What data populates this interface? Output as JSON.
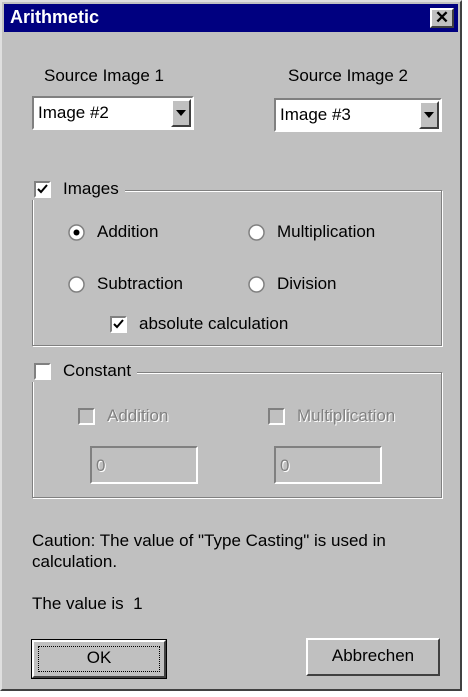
{
  "window": {
    "title": "Arithmetic"
  },
  "source1": {
    "label": "Source Image 1",
    "value": "Image #2"
  },
  "source2": {
    "label": "Source Image 2",
    "value": "Image #3"
  },
  "images_group": {
    "label": "Images",
    "checked": true,
    "addition": "Addition",
    "multiplication": "Multiplication",
    "subtraction": "Subtraction",
    "division": "Division",
    "absolute": "absolute calculation",
    "selected": "Addition"
  },
  "constant_group": {
    "label": "Constant",
    "checked": false,
    "addition": "Addition",
    "multiplication": "Multiplication",
    "addition_value": "0",
    "multiplication_value": "0"
  },
  "caution": "Caution: The value of \"Type Casting\" is used in calculation.",
  "value_text": "The value is  1",
  "buttons": {
    "ok": "OK",
    "cancel": "Abbrechen"
  }
}
